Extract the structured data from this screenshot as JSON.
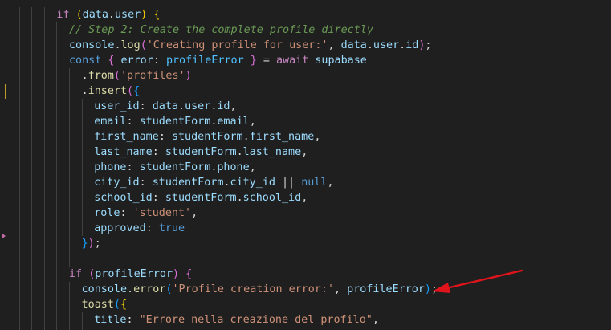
{
  "editor": {
    "lines": [
      {
        "indent": 4,
        "tokens": [
          [
            "kw2",
            "if"
          ],
          [
            "pun",
            " "
          ],
          [
            "br1",
            "("
          ],
          [
            "var",
            "data"
          ],
          [
            "pun",
            "."
          ],
          [
            "var",
            "user"
          ],
          [
            "br1",
            ")"
          ],
          [
            "pun",
            " "
          ],
          [
            "br1",
            "{"
          ]
        ]
      },
      {
        "indent": 5,
        "tokens": [
          [
            "com",
            "// Step 2: Create the complete profile directly"
          ]
        ]
      },
      {
        "indent": 5,
        "tokens": [
          [
            "var",
            "console"
          ],
          [
            "pun",
            "."
          ],
          [
            "fn",
            "log"
          ],
          [
            "br2",
            "("
          ],
          [
            "str",
            "'Creating profile for user:'"
          ],
          [
            "pun",
            ", "
          ],
          [
            "var",
            "data"
          ],
          [
            "pun",
            "."
          ],
          [
            "var",
            "user"
          ],
          [
            "pun",
            "."
          ],
          [
            "var",
            "id"
          ],
          [
            "br2",
            ")"
          ],
          [
            "pun",
            ";"
          ]
        ]
      },
      {
        "indent": 5,
        "tokens": [
          [
            "kw",
            "const"
          ],
          [
            "pun",
            " "
          ],
          [
            "br2",
            "{"
          ],
          [
            "pun",
            " "
          ],
          [
            "var",
            "error"
          ],
          [
            "pun",
            ": "
          ],
          [
            "const",
            "profileError"
          ],
          [
            "pun",
            " "
          ],
          [
            "br2",
            "}"
          ],
          [
            "pun",
            " = "
          ],
          [
            "kw2",
            "await"
          ],
          [
            "pun",
            " "
          ],
          [
            "var",
            "supabase"
          ]
        ]
      },
      {
        "indent": 6,
        "tokens": [
          [
            "pun",
            "."
          ],
          [
            "fn",
            "from"
          ],
          [
            "br2",
            "("
          ],
          [
            "str",
            "'profiles'"
          ],
          [
            "br2",
            ")"
          ]
        ]
      },
      {
        "indent": 6,
        "tokens": [
          [
            "pun",
            "."
          ],
          [
            "fn",
            "insert"
          ],
          [
            "br2",
            "("
          ],
          [
            "br3",
            "{"
          ]
        ]
      },
      {
        "indent": 7,
        "tokens": [
          [
            "var",
            "user_id"
          ],
          [
            "pun",
            ": "
          ],
          [
            "var",
            "data"
          ],
          [
            "pun",
            "."
          ],
          [
            "var",
            "user"
          ],
          [
            "pun",
            "."
          ],
          [
            "var",
            "id"
          ],
          [
            "pun",
            ","
          ]
        ]
      },
      {
        "indent": 7,
        "tokens": [
          [
            "var",
            "email"
          ],
          [
            "pun",
            ": "
          ],
          [
            "var",
            "studentForm"
          ],
          [
            "pun",
            "."
          ],
          [
            "var",
            "email"
          ],
          [
            "pun",
            ","
          ]
        ]
      },
      {
        "indent": 7,
        "tokens": [
          [
            "var",
            "first_name"
          ],
          [
            "pun",
            ": "
          ],
          [
            "var",
            "studentForm"
          ],
          [
            "pun",
            "."
          ],
          [
            "var",
            "first_name"
          ],
          [
            "pun",
            ","
          ]
        ]
      },
      {
        "indent": 7,
        "tokens": [
          [
            "var",
            "last_name"
          ],
          [
            "pun",
            ": "
          ],
          [
            "var",
            "studentForm"
          ],
          [
            "pun",
            "."
          ],
          [
            "var",
            "last_name"
          ],
          [
            "pun",
            ","
          ]
        ]
      },
      {
        "indent": 7,
        "tokens": [
          [
            "var",
            "phone"
          ],
          [
            "pun",
            ": "
          ],
          [
            "var",
            "studentForm"
          ],
          [
            "pun",
            "."
          ],
          [
            "var",
            "phone"
          ],
          [
            "pun",
            ","
          ]
        ]
      },
      {
        "indent": 7,
        "tokens": [
          [
            "var",
            "city_id"
          ],
          [
            "pun",
            ": "
          ],
          [
            "var",
            "studentForm"
          ],
          [
            "pun",
            "."
          ],
          [
            "var",
            "city_id"
          ],
          [
            "pun",
            " || "
          ],
          [
            "lit",
            "null"
          ],
          [
            "pun",
            ","
          ]
        ]
      },
      {
        "indent": 7,
        "tokens": [
          [
            "var",
            "school_id"
          ],
          [
            "pun",
            ": "
          ],
          [
            "var",
            "studentForm"
          ],
          [
            "pun",
            "."
          ],
          [
            "var",
            "school_id"
          ],
          [
            "pun",
            ","
          ]
        ]
      },
      {
        "indent": 7,
        "tokens": [
          [
            "var",
            "role"
          ],
          [
            "pun",
            ": "
          ],
          [
            "str",
            "'student'"
          ],
          [
            "pun",
            ","
          ]
        ]
      },
      {
        "indent": 7,
        "tokens": [
          [
            "var",
            "approved"
          ],
          [
            "pun",
            ": "
          ],
          [
            "lit",
            "true"
          ]
        ]
      },
      {
        "indent": 6,
        "tokens": [
          [
            "br3",
            "}"
          ],
          [
            "br2",
            ")"
          ],
          [
            "pun",
            ";"
          ]
        ]
      },
      {
        "indent": 0,
        "tokens": []
      },
      {
        "indent": 5,
        "tokens": [
          [
            "kw2",
            "if"
          ],
          [
            "pun",
            " "
          ],
          [
            "br2",
            "("
          ],
          [
            "var",
            "profileError"
          ],
          [
            "br2",
            ")"
          ],
          [
            "pun",
            " "
          ],
          [
            "br2",
            "{"
          ]
        ]
      },
      {
        "indent": 6,
        "tokens": [
          [
            "var",
            "console"
          ],
          [
            "pun",
            "."
          ],
          [
            "fn",
            "error"
          ],
          [
            "br3",
            "("
          ],
          [
            "str",
            "'Profile creation error:'"
          ],
          [
            "pun",
            ", "
          ],
          [
            "var",
            "profileError"
          ],
          [
            "br3",
            ")"
          ],
          [
            "pun",
            ";"
          ]
        ]
      },
      {
        "indent": 6,
        "tokens": [
          [
            "fn",
            "toast"
          ],
          [
            "br3",
            "("
          ],
          [
            "br1",
            "{"
          ]
        ]
      },
      {
        "indent": 7,
        "tokens": [
          [
            "var",
            "title"
          ],
          [
            "pun",
            ": "
          ],
          [
            "str",
            "\"Errore nella creazione del profilo\""
          ],
          [
            "pun",
            ","
          ]
        ]
      }
    ]
  },
  "annotation": {
    "arrow_color": "#e0141a",
    "arrow_icon": "red-arrow-icon"
  },
  "colors": {
    "background": "#1f1f1f",
    "gutter_modified": "#bb9a2c",
    "fold_marker": "#c06aa6"
  }
}
